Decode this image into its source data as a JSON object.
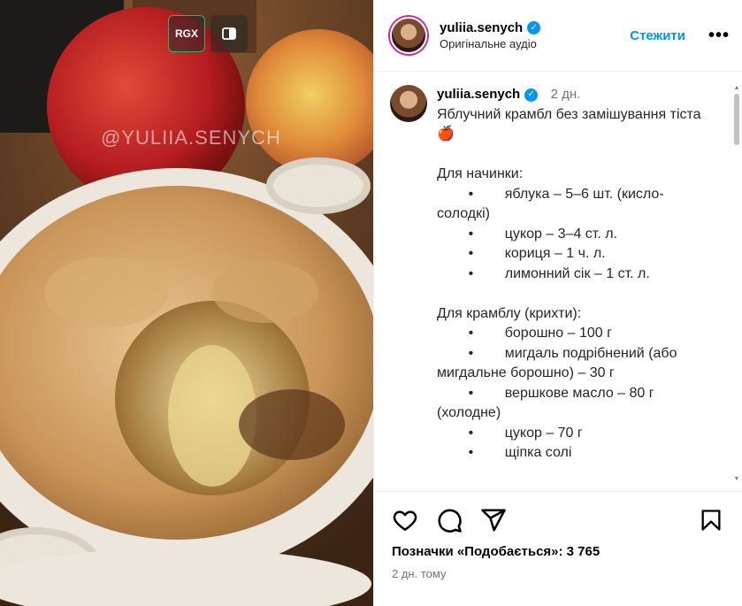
{
  "header": {
    "username": "yuliia.senych",
    "audio": "Оригінальне аудіо",
    "follow_label": "Стежити",
    "more_icon": "more-horizontal-icon"
  },
  "media": {
    "watermark": "@YULIIA.SENYCH",
    "overlay_buttons": {
      "rgx_label": "RGX",
      "side_icon": "panel-toggle-icon"
    }
  },
  "caption": {
    "username": "yuliia.senych",
    "time": "2 дн.",
    "text": "Яблучний крамбл без замішування тіста 🍎\n\nДля начинки:\n        •        яблука – 5–6 шт. (кисло-солодкі)\n        •        цукор – 3–4 ст. л.\n        •        кориця – 1 ч. л.\n        •        лимонний сік – 1 ст. л.\n\nДля крамблу (крихти):\n        •        борошно – 100 г\n        •        мигдаль подрібнений (або мигдальне борошно) – 30 г\n        •        вершкове масло – 80 г (холодне)\n        •        цукор – 70 г\n        •        щіпка солі"
  },
  "actions": {
    "like_icon": "heart-icon",
    "comment_icon": "comment-icon",
    "share_icon": "send-icon",
    "save_icon": "bookmark-icon"
  },
  "likes_text": "Позначки «Подобається»: 3 765",
  "posted": "2 дн. тому",
  "colors": {
    "accent": "#0095f6",
    "muted": "#737373"
  }
}
